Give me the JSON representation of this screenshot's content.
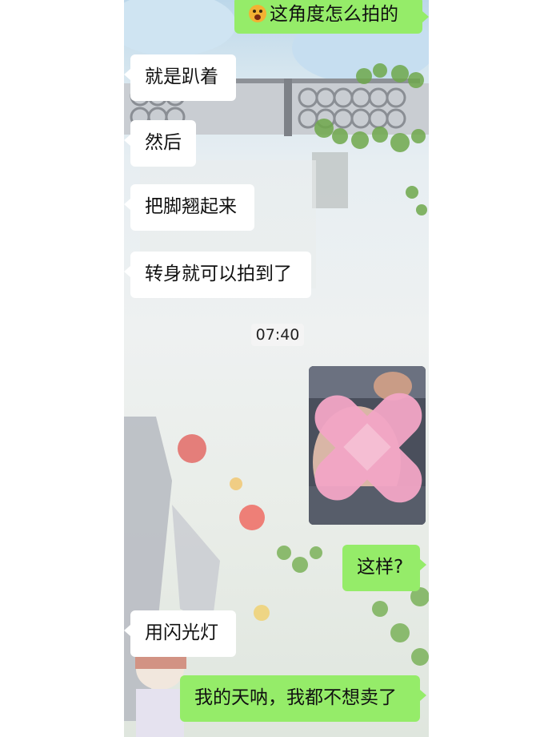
{
  "messages": [
    {
      "side": "right",
      "text": "这角度怎么拍的",
      "emoji": "astonished-face-icon"
    },
    {
      "side": "left",
      "text": "就是趴着"
    },
    {
      "side": "left",
      "text": "然后"
    },
    {
      "side": "left",
      "text": "把脚翘起来"
    },
    {
      "side": "left",
      "text": "转身就可以拍到了"
    },
    {
      "side": "left",
      "text": "用闪光灯"
    },
    {
      "side": "right",
      "text": "这样?"
    },
    {
      "side": "right",
      "text": "我的天呐，我都不想卖了"
    }
  ],
  "timestamp": "07:40",
  "photo": {
    "censor": "pink-bandage-sticker-icon"
  },
  "colors": {
    "sent_bubble": "#95ec69",
    "received_bubble": "#ffffff",
    "censor_pink": "#f3a6c6"
  }
}
